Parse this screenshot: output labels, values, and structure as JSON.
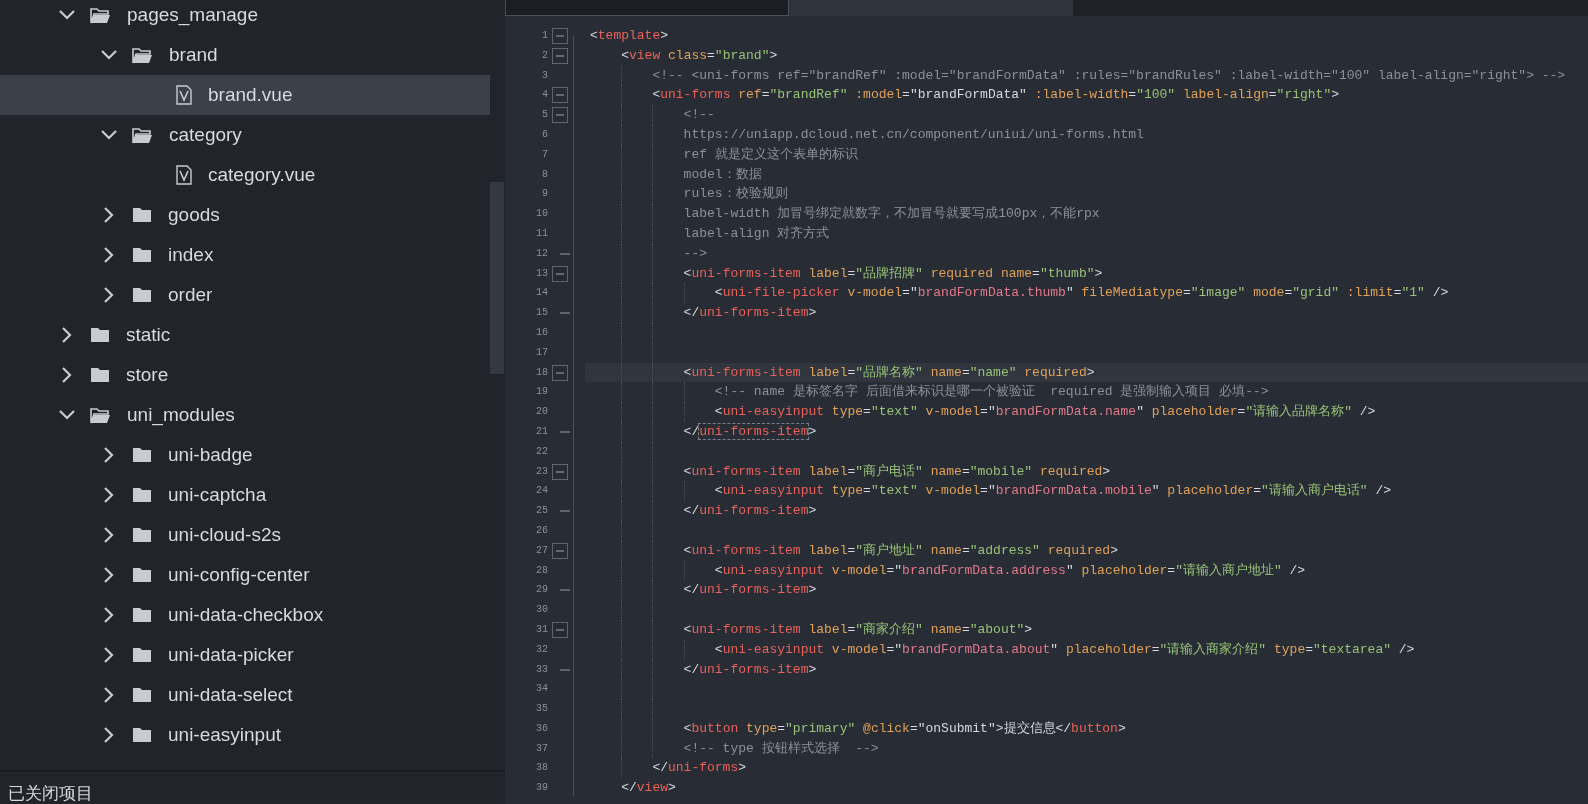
{
  "sidebar": {
    "tree": [
      {
        "kind": "folder",
        "name": "pages_manage",
        "expanded": true,
        "selected": false,
        "children": [
          {
            "kind": "folder",
            "name": "brand",
            "expanded": true,
            "selected": false,
            "children": [
              {
                "kind": "file",
                "name": "brand.vue",
                "selected": true
              }
            ]
          },
          {
            "kind": "folder",
            "name": "category",
            "expanded": true,
            "selected": false,
            "children": [
              {
                "kind": "file",
                "name": "category.vue",
                "selected": false
              }
            ]
          },
          {
            "kind": "folder",
            "name": "goods",
            "expanded": false,
            "selected": false
          },
          {
            "kind": "folder",
            "name": "index",
            "expanded": false,
            "selected": false
          },
          {
            "kind": "folder",
            "name": "order",
            "expanded": false,
            "selected": false
          }
        ]
      },
      {
        "kind": "folder",
        "name": "static",
        "expanded": false,
        "selected": false
      },
      {
        "kind": "folder",
        "name": "store",
        "expanded": false,
        "selected": false
      },
      {
        "kind": "folder",
        "name": "uni_modules",
        "expanded": true,
        "selected": false,
        "children": [
          {
            "kind": "folder",
            "name": "uni-badge",
            "expanded": false,
            "selected": false
          },
          {
            "kind": "folder",
            "name": "uni-captcha",
            "expanded": false,
            "selected": false
          },
          {
            "kind": "folder",
            "name": "uni-cloud-s2s",
            "expanded": false,
            "selected": false
          },
          {
            "kind": "folder",
            "name": "uni-config-center",
            "expanded": false,
            "selected": false
          },
          {
            "kind": "folder",
            "name": "uni-data-checkbox",
            "expanded": false,
            "selected": false
          },
          {
            "kind": "folder",
            "name": "uni-data-picker",
            "expanded": false,
            "selected": false
          },
          {
            "kind": "folder",
            "name": "uni-data-select",
            "expanded": false,
            "selected": false
          },
          {
            "kind": "folder",
            "name": "uni-easyinput",
            "expanded": false,
            "selected": false
          }
        ]
      }
    ],
    "bottom_panel": {
      "title": "已关闭项目"
    }
  },
  "editor": {
    "tabs": [
      {
        "selected": false
      },
      {
        "selected": true
      }
    ],
    "lines": [
      {
        "number": "1",
        "fold_start": true,
        "fold_end": false,
        "current": false,
        "matched": false,
        "tokens": [
          {
            "kind": "plain",
            "text": "<"
          },
          {
            "kind": "tag",
            "text": "template"
          },
          {
            "kind": "plain",
            "text": ">"
          }
        ]
      },
      {
        "number": "2",
        "fold_start": true,
        "fold_end": false,
        "current": false,
        "matched": false,
        "tokens": [
          {
            "kind": "plain",
            "text": "    <"
          },
          {
            "kind": "tag",
            "text": "view"
          },
          {
            "kind": "attr",
            "text": " class"
          },
          {
            "kind": "plain",
            "text": "="
          },
          {
            "kind": "string",
            "text": "\"brand\""
          },
          {
            "kind": "plain",
            "text": ">"
          }
        ]
      },
      {
        "number": "3",
        "fold_start": false,
        "fold_end": false,
        "current": false,
        "matched": false,
        "tokens": [
          {
            "kind": "comment",
            "text": "        <!-- <uni-forms ref=\"brandRef\" :model=\"brandFormData\" :rules=\"brandRules\" :label-width=\"100\" label-align=\"right\"> -->"
          }
        ]
      },
      {
        "number": "4",
        "fold_start": true,
        "fold_end": false,
        "current": false,
        "matched": false,
        "tokens": [
          {
            "kind": "plain",
            "text": "        <"
          },
          {
            "kind": "tag",
            "text": "uni-forms"
          },
          {
            "kind": "attr",
            "text": " ref"
          },
          {
            "kind": "plain",
            "text": "="
          },
          {
            "kind": "string",
            "text": "\"brandRef\""
          },
          {
            "kind": "attr",
            "text": " :model"
          },
          {
            "kind": "plain",
            "text": "=\"brandFormData\""
          },
          {
            "kind": "attr",
            "text": " :label-width"
          },
          {
            "kind": "plain",
            "text": "="
          },
          {
            "kind": "string",
            "text": "\"100\""
          },
          {
            "kind": "attr",
            "text": " label-align"
          },
          {
            "kind": "plain",
            "text": "="
          },
          {
            "kind": "string",
            "text": "\"right\""
          },
          {
            "kind": "plain",
            "text": ">"
          }
        ]
      },
      {
        "number": "5",
        "fold_start": true,
        "fold_end": false,
        "current": false,
        "matched": false,
        "tokens": [
          {
            "kind": "comment",
            "text": "            <!--"
          }
        ]
      },
      {
        "number": "6",
        "fold_start": false,
        "fold_end": false,
        "current": false,
        "matched": false,
        "tokens": [
          {
            "kind": "comment",
            "text": "            https://uniapp.dcloud.net.cn/component/uniui/uni-forms.html"
          }
        ]
      },
      {
        "number": "7",
        "fold_start": false,
        "fold_end": false,
        "current": false,
        "matched": false,
        "tokens": [
          {
            "kind": "comment",
            "text": "            ref 就是定义这个表单的标识"
          }
        ]
      },
      {
        "number": "8",
        "fold_start": false,
        "fold_end": false,
        "current": false,
        "matched": false,
        "tokens": [
          {
            "kind": "comment",
            "text": "            model：数据"
          }
        ]
      },
      {
        "number": "9",
        "fold_start": false,
        "fold_end": false,
        "current": false,
        "matched": false,
        "tokens": [
          {
            "kind": "comment",
            "text": "            rules：校验规则"
          }
        ]
      },
      {
        "number": "10",
        "fold_start": false,
        "fold_end": false,
        "current": false,
        "matched": false,
        "tokens": [
          {
            "kind": "comment",
            "text": "            label-width 加冒号绑定就数字，不加冒号就要写成100px，不能rpx"
          }
        ]
      },
      {
        "number": "11",
        "fold_start": false,
        "fold_end": false,
        "current": false,
        "matched": false,
        "tokens": [
          {
            "kind": "comment",
            "text": "            label-align 对齐方式"
          }
        ]
      },
      {
        "number": "12",
        "fold_start": false,
        "fold_end": true,
        "current": false,
        "matched": false,
        "tokens": [
          {
            "kind": "comment",
            "text": "            -->"
          }
        ]
      },
      {
        "number": "13",
        "fold_start": true,
        "fold_end": false,
        "current": false,
        "matched": false,
        "tokens": [
          {
            "kind": "plain",
            "text": "            <"
          },
          {
            "kind": "tag",
            "text": "uni-forms-item"
          },
          {
            "kind": "attr",
            "text": " label"
          },
          {
            "kind": "plain",
            "text": "="
          },
          {
            "kind": "string",
            "text": "\"品牌招牌\""
          },
          {
            "kind": "attr",
            "text": " required name"
          },
          {
            "kind": "plain",
            "text": "="
          },
          {
            "kind": "string",
            "text": "\"thumb\""
          },
          {
            "kind": "plain",
            "text": ">"
          }
        ]
      },
      {
        "number": "14",
        "fold_start": false,
        "fold_end": false,
        "current": false,
        "matched": false,
        "tokens": [
          {
            "kind": "plain",
            "text": "                <"
          },
          {
            "kind": "tag",
            "text": "uni-file-picker"
          },
          {
            "kind": "attr",
            "text": " v-model"
          },
          {
            "kind": "plain",
            "text": "=\""
          },
          {
            "kind": "expr",
            "text": "brandFormData.thumb"
          },
          {
            "kind": "plain",
            "text": "\""
          },
          {
            "kind": "attr",
            "text": " fileMediatype"
          },
          {
            "kind": "plain",
            "text": "="
          },
          {
            "kind": "string",
            "text": "\"image\""
          },
          {
            "kind": "attr",
            "text": " mode"
          },
          {
            "kind": "plain",
            "text": "="
          },
          {
            "kind": "string",
            "text": "\"grid\""
          },
          {
            "kind": "attr",
            "text": " :limit"
          },
          {
            "kind": "plain",
            "text": "="
          },
          {
            "kind": "string",
            "text": "\"1\""
          },
          {
            "kind": "plain",
            "text": " />"
          }
        ]
      },
      {
        "number": "15",
        "fold_start": false,
        "fold_end": true,
        "current": false,
        "matched": false,
        "tokens": [
          {
            "kind": "plain",
            "text": "            </"
          },
          {
            "kind": "tag",
            "text": "uni-forms-item"
          },
          {
            "kind": "plain",
            "text": ">"
          }
        ]
      },
      {
        "number": "16",
        "fold_start": false,
        "fold_end": false,
        "current": false,
        "matched": false
      },
      {
        "number": "17",
        "fold_start": false,
        "fold_end": false,
        "current": false,
        "matched": false
      },
      {
        "number": "18",
        "fold_start": true,
        "fold_end": false,
        "current": true,
        "matched": false,
        "tokens": [
          {
            "kind": "plain",
            "text": "            <"
          },
          {
            "kind": "tag",
            "text": "uni-forms-item"
          },
          {
            "kind": "attr",
            "text": " label"
          },
          {
            "kind": "plain",
            "text": "="
          },
          {
            "kind": "string",
            "text": "\"品牌名称\""
          },
          {
            "kind": "attr",
            "text": " name"
          },
          {
            "kind": "plain",
            "text": "="
          },
          {
            "kind": "string",
            "text": "\"name\""
          },
          {
            "kind": "attr",
            "text": " required"
          },
          {
            "kind": "plain",
            "text": ">"
          }
        ]
      },
      {
        "number": "19",
        "fold_start": false,
        "fold_end": false,
        "current": false,
        "matched": false,
        "tokens": [
          {
            "kind": "comment",
            "text": "                <!-- name 是标签名字 后面借来标识是哪一个被验证  required 是强制输入项目 必填-->"
          }
        ]
      },
      {
        "number": "20",
        "fold_start": false,
        "fold_end": false,
        "current": false,
        "matched": false,
        "tokens": [
          {
            "kind": "plain",
            "text": "                <"
          },
          {
            "kind": "tag",
            "text": "uni-easyinput"
          },
          {
            "kind": "attr",
            "text": " type"
          },
          {
            "kind": "plain",
            "text": "="
          },
          {
            "kind": "string",
            "text": "\"text\""
          },
          {
            "kind": "attr",
            "text": " v-model"
          },
          {
            "kind": "plain",
            "text": "=\""
          },
          {
            "kind": "expr",
            "text": "brandFormData.name"
          },
          {
            "kind": "plain",
            "text": "\""
          },
          {
            "kind": "attr",
            "text": " placeholder"
          },
          {
            "kind": "plain",
            "text": "="
          },
          {
            "kind": "string",
            "text": "\"请输入品牌名称\""
          },
          {
            "kind": "plain",
            "text": " />"
          }
        ]
      },
      {
        "number": "21",
        "fold_start": false,
        "fold_end": true,
        "current": false,
        "matched": true,
        "tokens": [
          {
            "kind": "plain",
            "text": "            </"
          },
          {
            "kind": "tag",
            "text": "uni-forms-item"
          },
          {
            "kind": "plain",
            "text": ">"
          }
        ]
      },
      {
        "number": "22",
        "fold_start": false,
        "fold_end": false,
        "current": false,
        "matched": false
      },
      {
        "number": "23",
        "fold_start": true,
        "fold_end": false,
        "current": false,
        "matched": false,
        "tokens": [
          {
            "kind": "plain",
            "text": "            <"
          },
          {
            "kind": "tag",
            "text": "uni-forms-item"
          },
          {
            "kind": "attr",
            "text": " label"
          },
          {
            "kind": "plain",
            "text": "="
          },
          {
            "kind": "string",
            "text": "\"商户电话\""
          },
          {
            "kind": "attr",
            "text": " name"
          },
          {
            "kind": "plain",
            "text": "="
          },
          {
            "kind": "string",
            "text": "\"mobile\""
          },
          {
            "kind": "attr",
            "text": " required"
          },
          {
            "kind": "plain",
            "text": ">"
          }
        ]
      },
      {
        "number": "24",
        "fold_start": false,
        "fold_end": false,
        "current": false,
        "matched": false,
        "tokens": [
          {
            "kind": "plain",
            "text": "                <"
          },
          {
            "kind": "tag",
            "text": "uni-easyinput"
          },
          {
            "kind": "attr",
            "text": " type"
          },
          {
            "kind": "plain",
            "text": "="
          },
          {
            "kind": "string",
            "text": "\"text\""
          },
          {
            "kind": "attr",
            "text": " v-model"
          },
          {
            "kind": "plain",
            "text": "=\""
          },
          {
            "kind": "expr",
            "text": "brandFormData.mobile"
          },
          {
            "kind": "plain",
            "text": "\""
          },
          {
            "kind": "attr",
            "text": " placeholder"
          },
          {
            "kind": "plain",
            "text": "="
          },
          {
            "kind": "string",
            "text": "\"请输入商户电话\""
          },
          {
            "kind": "plain",
            "text": " />"
          }
        ]
      },
      {
        "number": "25",
        "fold_start": false,
        "fold_end": true,
        "current": false,
        "matched": false,
        "tokens": [
          {
            "kind": "plain",
            "text": "            </"
          },
          {
            "kind": "tag",
            "text": "uni-forms-item"
          },
          {
            "kind": "plain",
            "text": ">"
          }
        ]
      },
      {
        "number": "26",
        "fold_start": false,
        "fold_end": false,
        "current": false,
        "matched": false
      },
      {
        "number": "27",
        "fold_start": true,
        "fold_end": false,
        "current": false,
        "matched": false,
        "tokens": [
          {
            "kind": "plain",
            "text": "            <"
          },
          {
            "kind": "tag",
            "text": "uni-forms-item"
          },
          {
            "kind": "attr",
            "text": " label"
          },
          {
            "kind": "plain",
            "text": "="
          },
          {
            "kind": "string",
            "text": "\"商户地址\""
          },
          {
            "kind": "attr",
            "text": " name"
          },
          {
            "kind": "plain",
            "text": "="
          },
          {
            "kind": "string",
            "text": "\"address\""
          },
          {
            "kind": "attr",
            "text": " required"
          },
          {
            "kind": "plain",
            "text": ">"
          }
        ]
      },
      {
        "number": "28",
        "fold_start": false,
        "fold_end": false,
        "current": false,
        "matched": false,
        "tokens": [
          {
            "kind": "plain",
            "text": "                <"
          },
          {
            "kind": "tag",
            "text": "uni-easyinput"
          },
          {
            "kind": "attr",
            "text": " v-model"
          },
          {
            "kind": "plain",
            "text": "=\""
          },
          {
            "kind": "expr",
            "text": "brandFormData.address"
          },
          {
            "kind": "plain",
            "text": "\""
          },
          {
            "kind": "attr",
            "text": " placeholder"
          },
          {
            "kind": "plain",
            "text": "="
          },
          {
            "kind": "string",
            "text": "\"请输入商户地址\""
          },
          {
            "kind": "plain",
            "text": " />"
          }
        ]
      },
      {
        "number": "29",
        "fold_start": false,
        "fold_end": true,
        "current": false,
        "matched": false,
        "tokens": [
          {
            "kind": "plain",
            "text": "            </"
          },
          {
            "kind": "tag",
            "text": "uni-forms-item"
          },
          {
            "kind": "plain",
            "text": ">"
          }
        ]
      },
      {
        "number": "30",
        "fold_start": false,
        "fold_end": false,
        "current": false,
        "matched": false
      },
      {
        "number": "31",
        "fold_start": true,
        "fold_end": false,
        "current": false,
        "matched": false,
        "tokens": [
          {
            "kind": "plain",
            "text": "            <"
          },
          {
            "kind": "tag",
            "text": "uni-forms-item"
          },
          {
            "kind": "attr",
            "text": " label"
          },
          {
            "kind": "plain",
            "text": "="
          },
          {
            "kind": "string",
            "text": "\"商家介绍\""
          },
          {
            "kind": "attr",
            "text": " name"
          },
          {
            "kind": "plain",
            "text": "="
          },
          {
            "kind": "string",
            "text": "\"about\""
          },
          {
            "kind": "plain",
            "text": ">"
          }
        ]
      },
      {
        "number": "32",
        "fold_start": false,
        "fold_end": false,
        "current": false,
        "matched": false,
        "tokens": [
          {
            "kind": "plain",
            "text": "                <"
          },
          {
            "kind": "tag",
            "text": "uni-easyinput"
          },
          {
            "kind": "attr",
            "text": " v-model"
          },
          {
            "kind": "plain",
            "text": "=\""
          },
          {
            "kind": "expr",
            "text": "brandFormData.about"
          },
          {
            "kind": "plain",
            "text": "\""
          },
          {
            "kind": "attr",
            "text": " placeholder"
          },
          {
            "kind": "plain",
            "text": "="
          },
          {
            "kind": "string",
            "text": "\"请输入商家介绍\""
          },
          {
            "kind": "attr",
            "text": " type"
          },
          {
            "kind": "plain",
            "text": "="
          },
          {
            "kind": "string",
            "text": "\"textarea\""
          },
          {
            "kind": "plain",
            "text": " />"
          }
        ]
      },
      {
        "number": "33",
        "fold_start": false,
        "fold_end": true,
        "current": false,
        "matched": false,
        "tokens": [
          {
            "kind": "plain",
            "text": "            </"
          },
          {
            "kind": "tag",
            "text": "uni-forms-item"
          },
          {
            "kind": "plain",
            "text": ">"
          }
        ]
      },
      {
        "number": "34",
        "fold_start": false,
        "fold_end": false,
        "current": false,
        "matched": false
      },
      {
        "number": "35",
        "fold_start": false,
        "fold_end": false,
        "current": false,
        "matched": false
      },
      {
        "number": "36",
        "fold_start": false,
        "fold_end": false,
        "current": false,
        "matched": false,
        "tokens": [
          {
            "kind": "plain",
            "text": "            <"
          },
          {
            "kind": "tag",
            "text": "button"
          },
          {
            "kind": "attr",
            "text": " type"
          },
          {
            "kind": "plain",
            "text": "="
          },
          {
            "kind": "string",
            "text": "\"primary\""
          },
          {
            "kind": "attr",
            "text": " @click"
          },
          {
            "kind": "plain",
            "text": "=\"onSubmit\">提交信息</"
          },
          {
            "kind": "tag",
            "text": "button"
          },
          {
            "kind": "plain",
            "text": ">"
          }
        ]
      },
      {
        "number": "37",
        "fold_start": false,
        "fold_end": false,
        "current": false,
        "matched": false,
        "tokens": [
          {
            "kind": "comment",
            "text": "            <!-- type 按钮样式选择  -->"
          }
        ]
      },
      {
        "number": "38",
        "fold_start": false,
        "fold_end": false,
        "current": false,
        "matched": false,
        "tokens": [
          {
            "kind": "plain",
            "text": "        </"
          },
          {
            "kind": "tag",
            "text": "uni-forms"
          },
          {
            "kind": "plain",
            "text": ">"
          }
        ]
      },
      {
        "number": "39",
        "fold_start": false,
        "fold_end": false,
        "current": false,
        "matched": false,
        "tokens": [
          {
            "kind": "plain",
            "text": "    </"
          },
          {
            "kind": "tag",
            "text": "view"
          },
          {
            "kind": "plain",
            "text": ">"
          }
        ]
      }
    ]
  }
}
